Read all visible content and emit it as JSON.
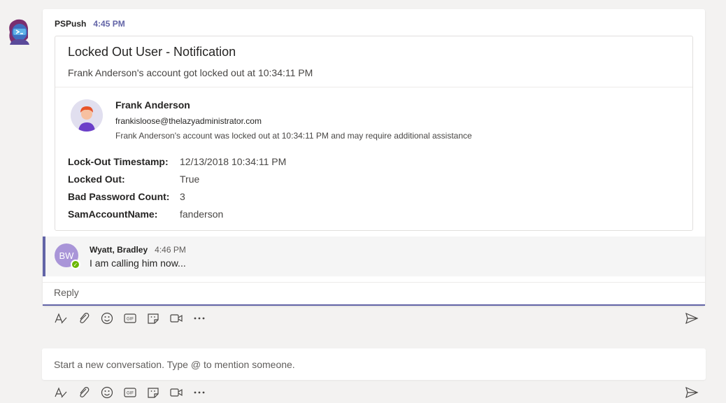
{
  "message": {
    "sender": "PSPush",
    "time": "4:45 PM"
  },
  "card": {
    "title": "Locked Out User - Notification",
    "subtitle": "Frank Anderson's account got locked out at 10:34:11 PM",
    "person": {
      "name": "Frank Anderson",
      "email": "frankisloose@thelazyadministrator.com",
      "note": "Frank Anderson's account was locked out at 10:34:11 PM and may require additional assistance"
    },
    "facts": [
      {
        "key": "Lock-Out Timestamp:",
        "value": "12/13/2018 10:34:11 PM"
      },
      {
        "key": "Locked Out:",
        "value": "True"
      },
      {
        "key": "Bad Password Count:",
        "value": "3"
      },
      {
        "key": "SamAccountName:",
        "value": "fanderson"
      }
    ]
  },
  "reply": {
    "initials": "BW",
    "name": "Wyatt, Bradley",
    "time": "4:46 PM",
    "text": "I am calling him now..."
  },
  "reply_box": {
    "placeholder": "Reply"
  },
  "new_conversation": {
    "placeholder": "Start a new conversation. Type @ to mention someone."
  },
  "icons": {
    "format": "format-icon",
    "attach": "paperclip-icon",
    "emoji": "emoji-icon",
    "gif": "gif-icon",
    "sticker": "sticker-icon",
    "meet": "meet-now-icon",
    "more": "more-options-icon",
    "send": "send-icon",
    "gif_label": "GIF"
  },
  "colors": {
    "accent": "#6264a7",
    "presence": "#6bb700",
    "reply_avatar": "#a995d8"
  }
}
